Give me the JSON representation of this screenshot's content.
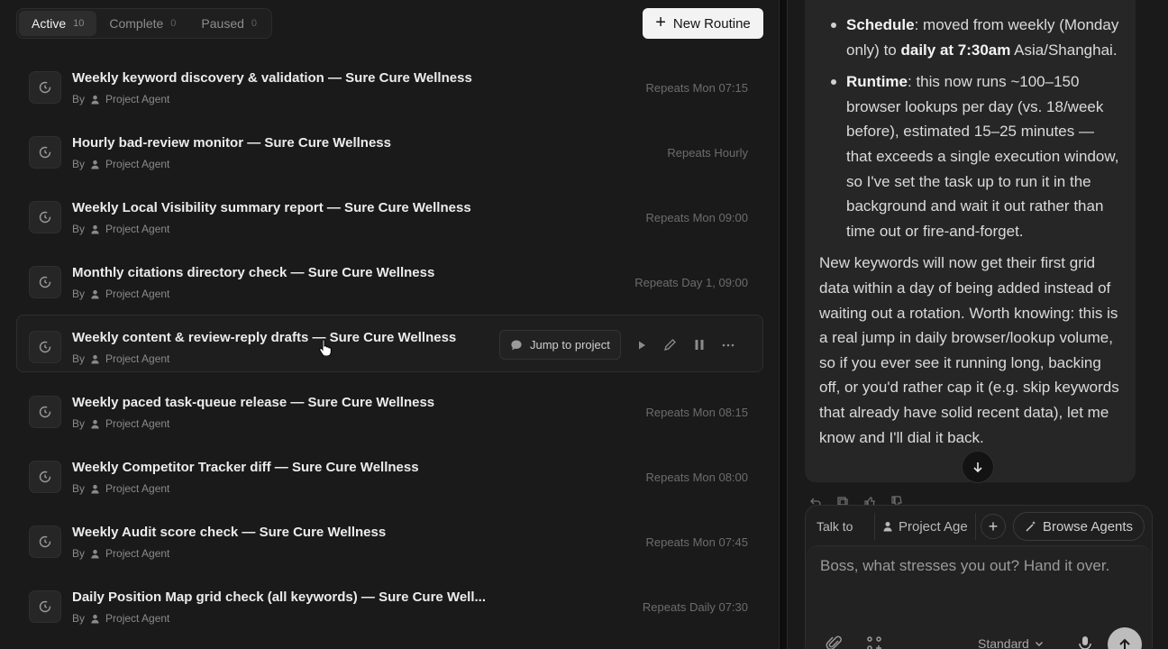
{
  "tabs": [
    {
      "label": "Active",
      "count": "10"
    },
    {
      "label": "Complete",
      "count": "0"
    },
    {
      "label": "Paused",
      "count": "0"
    }
  ],
  "new_routine_label": "New Routine",
  "routines": [
    {
      "title": "Weekly keyword discovery & validation — Sure Cure Wellness",
      "by": "By",
      "agent": "Project Agent",
      "schedule": "Repeats Mon 07:15"
    },
    {
      "title": "Hourly bad-review monitor — Sure Cure Wellness",
      "by": "By",
      "agent": "Project Agent",
      "schedule": "Repeats Hourly"
    },
    {
      "title": "Weekly Local Visibility summary report — Sure Cure Wellness",
      "by": "By",
      "agent": "Project Agent",
      "schedule": "Repeats Mon 09:00"
    },
    {
      "title": "Monthly citations directory check — Sure Cure Wellness",
      "by": "By",
      "agent": "Project Agent",
      "schedule": "Repeats Day 1, 09:00"
    },
    {
      "title": "Weekly content & review-reply drafts — Sure Cure Wellness",
      "by": "By",
      "agent": "Project Agent",
      "schedule": ""
    },
    {
      "title": "Weekly paced task-queue release — Sure Cure Wellness",
      "by": "By",
      "agent": "Project Agent",
      "schedule": "Repeats Mon 08:15"
    },
    {
      "title": "Weekly Competitor Tracker diff — Sure Cure Wellness",
      "by": "By",
      "agent": "Project Agent",
      "schedule": "Repeats Mon 08:00"
    },
    {
      "title": "Weekly Audit score check — Sure Cure Wellness",
      "by": "By",
      "agent": "Project Agent",
      "schedule": "Repeats Mon 07:45"
    },
    {
      "title": "Daily Position Map grid check (all keywords) — Sure Cure Well...",
      "by": "By",
      "agent": "Project Agent",
      "schedule": "Repeats Daily 07:30"
    }
  ],
  "hover_actions": {
    "jump_label": "Jump to project"
  },
  "message": {
    "b1_label": "Schedule",
    "b1_text_a": ": moved from weekly (Monday only) to ",
    "b1_bold": "daily at 7:30am",
    "b1_text_b": " Asia/Shanghai.",
    "b2_label": "Runtime",
    "b2_text": ": this now runs ~100–150 browser lookups per day (vs. 18/week before), estimated 15–25 minutes — that exceeds a single execution window, so I've set the task up to run it in the background and wait it out rather than time out or fire-and-forget.",
    "para": "New keywords will now get their first grid data within a day of being added instead of waiting out a rotation. Worth knowing: this is a real jump in daily browser/lookup volume, so if you ever see it running long, backing off, or you'd rather cap it (e.g. skip keywords that already have solid recent data), let me know and I'll dial it back."
  },
  "composer": {
    "talk_to": "Talk to",
    "agent": "Project Age",
    "browse_agents": "Browse Agents",
    "placeholder": "Boss, what stresses you out? Hand it over.",
    "mode": "Standard"
  }
}
